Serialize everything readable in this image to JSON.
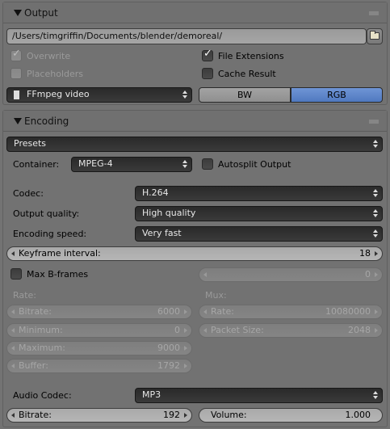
{
  "output": {
    "title": "Output",
    "path": "/Users/timgriffin/Documents/blender/demoreal/",
    "overwrite_label": "Overwrite",
    "overwrite_checked": true,
    "file_extensions_label": "File Extensions",
    "file_extensions_checked": true,
    "placeholders_label": "Placeholders",
    "placeholders_checked": false,
    "cache_result_label": "Cache Result",
    "cache_result_checked": false,
    "format_value": "FFmpeg video",
    "color_mode": {
      "bw": "BW",
      "rgb": "RGB",
      "selected": "RGB"
    }
  },
  "encoding": {
    "title": "Encoding",
    "presets_label": "Presets",
    "container_label": "Container:",
    "container_value": "MPEG-4",
    "autosplit_label": "Autosplit Output",
    "autosplit_checked": false,
    "codec_label": "Codec:",
    "codec_value": "H.264",
    "quality_label": "Output quality:",
    "quality_value": "High quality",
    "speed_label": "Encoding speed:",
    "speed_value": "Very fast",
    "keyframe_label": "Keyframe interval:",
    "keyframe_value": "18",
    "max_bframes_label": "Max B-frames",
    "max_bframes_checked": false,
    "max_bframes_value": "0",
    "rate_header": "Rate:",
    "mux_header": "Mux:",
    "bitrate_label": "Bitrate:",
    "bitrate_value": "6000",
    "minimum_label": "Minimum:",
    "minimum_value": "0",
    "maximum_label": "Maximum:",
    "maximum_value": "9000",
    "buffer_label": "Buffer:",
    "buffer_value": "1792",
    "mux_rate_label": "Rate:",
    "mux_rate_value": "10080000",
    "packet_size_label": "Packet Size:",
    "packet_size_value": "2048",
    "audio_codec_label": "Audio Codec:",
    "audio_codec_value": "MP3",
    "audio_bitrate_label": "Bitrate:",
    "audio_bitrate_value": "192",
    "volume_label": "Volume:",
    "volume_value": "1.000"
  },
  "colors": {
    "accent_blue": "#5c85c9",
    "panel_bg": "#727272",
    "dark_field": "#2f2f2f"
  }
}
